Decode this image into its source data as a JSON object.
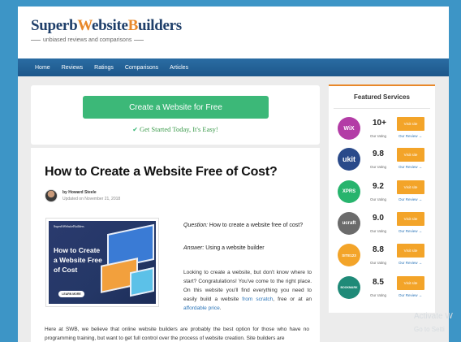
{
  "header": {
    "logo_part1": "Superb",
    "logo_part2": "W",
    "logo_part3": "ebsite",
    "logo_part4": "B",
    "logo_part5": "uilders",
    "tagline": "unbiased reviews and comparisons"
  },
  "nav": {
    "items": [
      {
        "label": "Home"
      },
      {
        "label": "Reviews"
      },
      {
        "label": "Ratings"
      },
      {
        "label": "Comparisons"
      },
      {
        "label": "Articles"
      }
    ]
  },
  "cta": {
    "button_label": "Create a Website for Free",
    "sub_label": "Get Started Today, It's Easy!"
  },
  "article": {
    "title": "How to Create a Website Free of Cost?",
    "author": "by Howard Steele",
    "date": "Updated on November 21, 2018",
    "thumb_brand": "SuperbWebsiteBuilders",
    "thumb_title": "How to Create a Website Free of Cost",
    "thumb_button": "LEARN MORE",
    "question_label": "Question:",
    "question_text": " How to create a website free of cost?",
    "answer_label": "Answer:",
    "answer_text": " Using a website builder",
    "para_part1": "Looking to create a website, but don't know where to start? Congratulations! You've come to the right place. On this website you'll find everything you need to easily build a website ",
    "para_link1": "from scratch",
    "para_part2": ", free or at an ",
    "para_link2": "affordable price",
    "para_part3": ".",
    "para2": "Here at SWB, we believe that online website builders are probably the best option for those who have no programming training, but want to get full control over the process of website creation. Site builders are"
  },
  "sidebar": {
    "title": "Featured Services",
    "services": [
      {
        "logo": "WiX",
        "score": "10+",
        "label": "Our rating",
        "button": "Visit site",
        "review": "Our Review →",
        "color": "#b33ca6"
      },
      {
        "logo": "ukit",
        "score": "9.8",
        "label": "Our rating",
        "button": "Visit site",
        "review": "Our Review →",
        "color": "#2a4a8a"
      },
      {
        "logo": "XPRS",
        "score": "9.2",
        "label": "Our rating",
        "button": "Visit site",
        "review": "Our Review →",
        "color": "#27b46d"
      },
      {
        "logo": "ucraft",
        "score": "9.0",
        "label": "Our rating",
        "button": "Visit site",
        "review": "Our Review →",
        "color": "#6b6b6b"
      },
      {
        "logo": "SITE123",
        "score": "8.8",
        "label": "Our rating",
        "button": "Visit site",
        "review": "Our Review →",
        "color": "#f3a429"
      },
      {
        "logo": "BOOKMARK",
        "score": "8.5",
        "label": "Our rating",
        "button": "Visit site",
        "review": "Our Review →",
        "color": "#1f8a78"
      }
    ]
  },
  "watermark": {
    "line1": "Activate W",
    "line2": "Go to Setti"
  }
}
